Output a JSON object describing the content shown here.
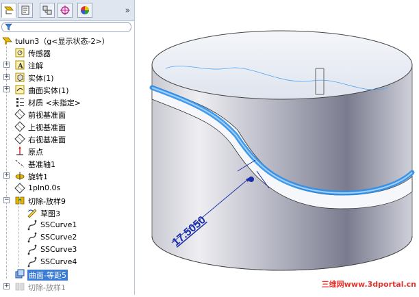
{
  "tree": {
    "root": "tulun3（g<显示状态-2>）",
    "items": [
      {
        "label": "传感器"
      },
      {
        "label": "注解"
      },
      {
        "label": "实体(1)"
      },
      {
        "label": "曲面实体(1)"
      },
      {
        "label": "材质 <未指定>"
      },
      {
        "label": "前视基准面"
      },
      {
        "label": "上视基准面"
      },
      {
        "label": "右视基准面"
      },
      {
        "label": "原点"
      },
      {
        "label": "基准轴1"
      },
      {
        "label": "旋转1"
      },
      {
        "label": "1pln0.0s"
      },
      {
        "label": "切除-放样9"
      },
      {
        "label": "草图3"
      },
      {
        "label": "SSCurve1"
      },
      {
        "label": "SSCurve2"
      },
      {
        "label": "SSCurve3"
      },
      {
        "label": "SSCurve4"
      },
      {
        "label": "曲面-等距5"
      },
      {
        "label": "切除-放样1"
      }
    ]
  },
  "viewport": {
    "dimension_value": "17.5050",
    "watermark": "三维网www.3dportal.cn"
  },
  "colors": {
    "selection": "#3a7bd5",
    "highlight_curve": "#2f8fe6",
    "dimension": "#1a2fa8",
    "watermark": "#e8322b"
  }
}
